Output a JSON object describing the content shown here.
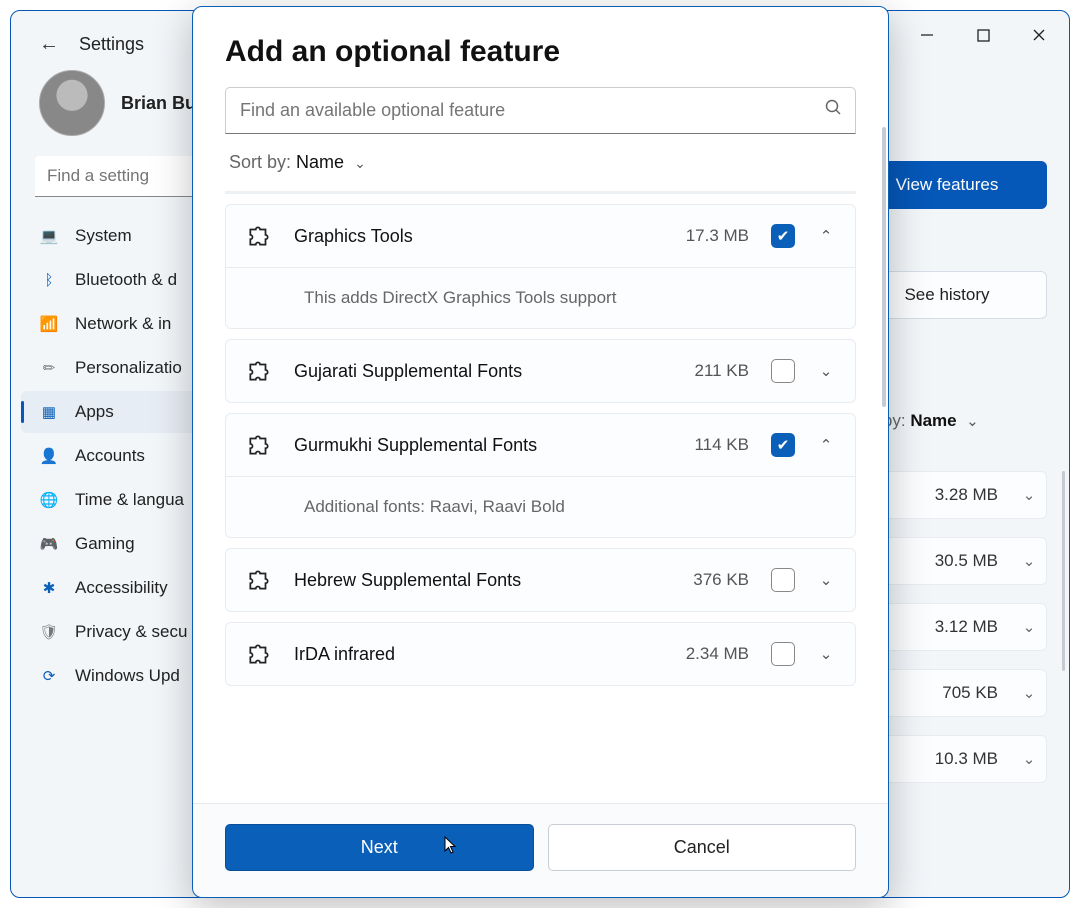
{
  "window": {
    "title": "Settings",
    "user_name": "Brian Bur",
    "find_setting_placeholder": "Find a setting",
    "sidebar": [
      {
        "label": "System",
        "icon": "💻",
        "color": "#0a5fb8"
      },
      {
        "label": "Bluetooth & d",
        "icon": "ᛒ",
        "color": "#0a5fb8"
      },
      {
        "label": "Network & in",
        "icon": "📶",
        "color": "#0a5fb8"
      },
      {
        "label": "Personalizatio",
        "icon": "✏",
        "color": "#777"
      },
      {
        "label": "Apps",
        "icon": "▦",
        "color": "#0a5fb8",
        "active": true
      },
      {
        "label": "Accounts",
        "icon": "👤",
        "color": "#0a5fb8"
      },
      {
        "label": "Time & langua",
        "icon": "🌐",
        "color": "#0a5fb8"
      },
      {
        "label": "Gaming",
        "icon": "🎮",
        "color": "#777"
      },
      {
        "label": "Accessibility",
        "icon": "✱",
        "color": "#0a5fb8"
      },
      {
        "label": "Privacy & secu",
        "icon": "🛡",
        "color": "#777"
      },
      {
        "label": "Windows Upd",
        "icon": "⟳",
        "color": "#0a5fb8"
      }
    ]
  },
  "right": {
    "view_features": "View features",
    "see_history": "See history",
    "sort_prefix": "Sort by: ",
    "sort_value": "Name",
    "rows": [
      "3.28 MB",
      "30.5 MB",
      "3.12 MB",
      "705 KB",
      "10.3 MB"
    ]
  },
  "modal": {
    "title": "Add an optional feature",
    "search_placeholder": "Find an available optional feature",
    "sort_prefix": "Sort by: ",
    "sort_value": "Name",
    "features": [
      {
        "name": "Graphics Tools",
        "size": "17.3 MB",
        "checked": true,
        "expanded": true,
        "desc": "This adds DirectX Graphics Tools support"
      },
      {
        "name": "Gujarati Supplemental Fonts",
        "size": "211 KB",
        "checked": false,
        "expanded": false
      },
      {
        "name": "Gurmukhi Supplemental Fonts",
        "size": "114 KB",
        "checked": true,
        "expanded": true,
        "desc": "Additional fonts: Raavi, Raavi Bold"
      },
      {
        "name": "Hebrew Supplemental Fonts",
        "size": "376 KB",
        "checked": false,
        "expanded": false
      },
      {
        "name": "IrDA infrared",
        "size": "2.34 MB",
        "checked": false,
        "expanded": false
      }
    ],
    "next": "Next",
    "cancel": "Cancel"
  }
}
